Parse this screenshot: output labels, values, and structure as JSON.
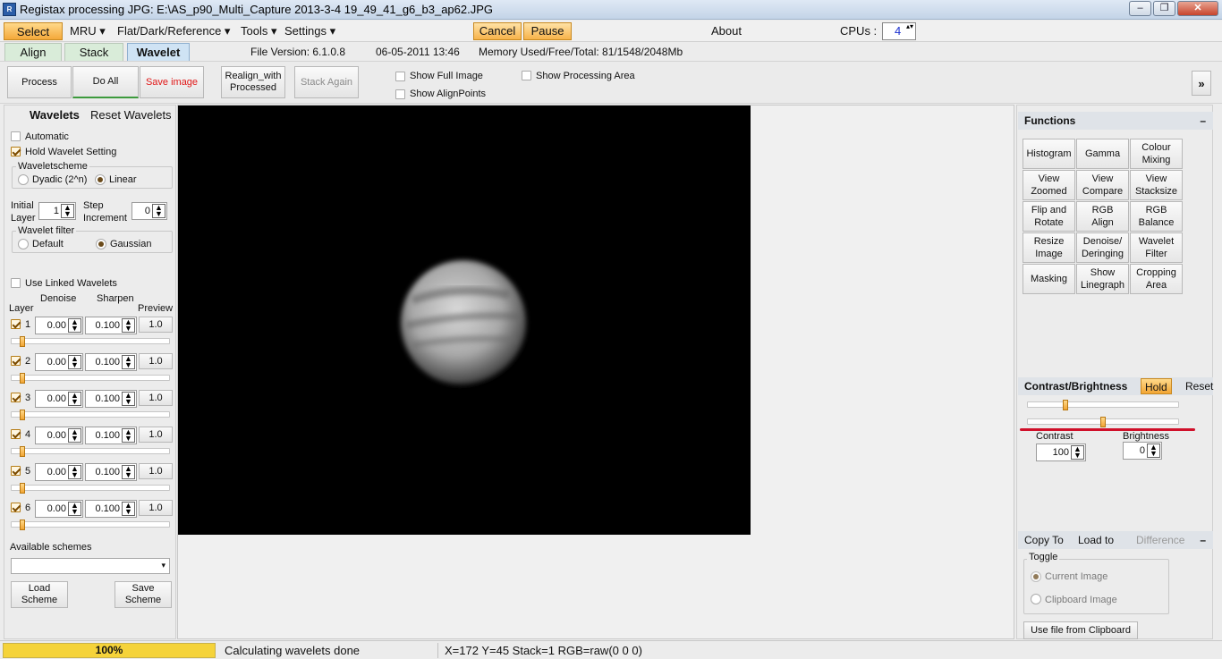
{
  "window": {
    "title": "Registax processing JPG: E:\\AS_p90_Multi_Capture 2013-3-4 19_49_41_g6_b3_ap62.JPG",
    "icon": "registax-app-icon",
    "minimize": "–",
    "maximize": "❐",
    "close": "✕"
  },
  "menu": {
    "select": "Select",
    "mru": "MRU ▾",
    "flat": "Flat/Dark/Reference ▾",
    "tools": "Tools ▾",
    "settings": "Settings ▾",
    "cancel": "Cancel",
    "pause": "Pause",
    "about": "About",
    "cpus_label": "CPUs :",
    "cpus_value": "4",
    "spin_arrows": "▴▾"
  },
  "tabs": {
    "align": "Align",
    "stack": "Stack",
    "wavelet": "Wavelet"
  },
  "info": {
    "file_version": "File Version: 6.1.0.8",
    "date": "06-05-2011 13:46",
    "memory": "Memory Used/Free/Total: 81/1548/2048Mb"
  },
  "toolbar": {
    "process": "Process",
    "do_all": "Do All",
    "save_image": "Save image",
    "realign_1": "Realign_with",
    "realign_2": "Processed",
    "stack_again": "Stack Again",
    "show_full_image": "Show Full Image",
    "show_alignpoints": "Show AlignPoints",
    "show_processing_area": "Show Processing Area",
    "expand": "»"
  },
  "wavelets": {
    "title": "Wavelets",
    "reset": "Reset Wavelets",
    "automatic": "Automatic",
    "hold": "Hold Wavelet Setting",
    "scheme_title": "Waveletscheme",
    "dyadic": "Dyadic (2^n)",
    "linear": "Linear",
    "initial_1": "Initial",
    "initial_2": "Layer",
    "initial_value": "1",
    "step_1": "Step",
    "step_2": "Increment",
    "step_value": "0",
    "filter_title": "Wavelet filter",
    "default": "Default",
    "gaussian": "Gaussian",
    "use_linked": "Use Linked Wavelets",
    "col_denoise": "Denoise",
    "col_sharpen": "Sharpen",
    "col_preview": "Preview",
    "col_layer": "Layer",
    "spin_glyph": "▲\n▼",
    "layers": [
      {
        "num": "1",
        "denoise": "0.00",
        "sharpen": "0.100",
        "preview": "1.0"
      },
      {
        "num": "2",
        "denoise": "0.00",
        "sharpen": "0.100",
        "preview": "1.0"
      },
      {
        "num": "3",
        "denoise": "0.00",
        "sharpen": "0.100",
        "preview": "1.0"
      },
      {
        "num": "4",
        "denoise": "0.00",
        "sharpen": "0.100",
        "preview": "1.0"
      },
      {
        "num": "5",
        "denoise": "0.00",
        "sharpen": "0.100",
        "preview": "1.0"
      },
      {
        "num": "6",
        "denoise": "0.00",
        "sharpen": "0.100",
        "preview": "1.0"
      }
    ],
    "available_schemes": "Available schemes",
    "scheme_value": "",
    "dropdown_arrow": "▾",
    "load_1": "Load",
    "load_2": "Scheme",
    "save_1": "Save",
    "save_2": "Scheme"
  },
  "functions": {
    "title": "Functions",
    "collapse": "–",
    "buttons": [
      [
        "Histogram"
      ],
      [
        "Gamma"
      ],
      [
        "Colour",
        "Mixing"
      ],
      [
        "View",
        "Zoomed"
      ],
      [
        "View",
        "Compare"
      ],
      [
        "View",
        "Stacksize"
      ],
      [
        "Flip and",
        "Rotate"
      ],
      [
        "RGB",
        "Align"
      ],
      [
        "RGB",
        "Balance"
      ],
      [
        "Resize",
        "Image"
      ],
      [
        "Denoise/",
        "Deringing"
      ],
      [
        "Wavelet",
        "Filter"
      ],
      [
        "Masking"
      ],
      [
        "Show",
        "Linegraph"
      ],
      [
        "Cropping",
        "Area"
      ]
    ]
  },
  "contrast": {
    "title": "Contrast/Brightness",
    "hold": "Hold",
    "reset": "Reset",
    "contrast_label": "Contrast",
    "contrast_value": "100",
    "brightness_label": "Brightness",
    "brightness_value": "0",
    "annotation_color": "#d0102a"
  },
  "copyto": {
    "copy_to": "Copy To",
    "load_to": "Load to",
    "difference": "Difference",
    "collapse": "–",
    "toggle": "Toggle",
    "current_image": "Current Image",
    "clipboard_image": "Clipboard Image",
    "use_file": "Use file from Clipboard"
  },
  "status": {
    "progress": "100%",
    "progress_fraction": 1.0,
    "message": "Calculating wavelets done",
    "coords": "X=172 Y=45 Stack=1 RGB=raw(0 0 0)"
  },
  "colors": {
    "accent": "#f7b24a",
    "progress": "#f5d33a",
    "tab_active": "#cfe3f4",
    "tab_inactive": "#d9ecd9"
  }
}
